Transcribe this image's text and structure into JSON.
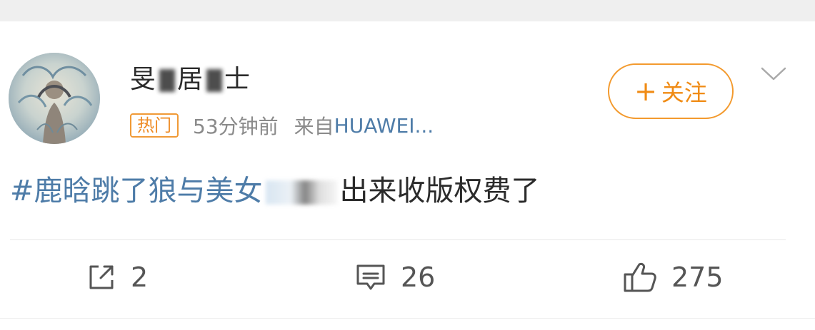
{
  "post": {
    "username": "旻 居 ",
    "username_visible_parts": [
      "旻",
      "居",
      "士"
    ],
    "hot_badge": "热门",
    "time": "53分钟前",
    "source_prefix": "来自",
    "source_name": "HUAWEI...",
    "follow_label": "关注",
    "follow_plus": "+",
    "content_topic": "#鹿晗跳了狼与美女",
    "content_rest": "出来收版权费了"
  },
  "actions": {
    "repost_count": "2",
    "comment_count": "26",
    "like_count": "275"
  },
  "colors": {
    "accent_orange": "#f39a2e",
    "link_blue": "#4e7ca8",
    "meta_gray": "#8a8a8a",
    "text_dark": "#2b2b2b"
  },
  "icons": {
    "avatar": "illustrated-avatar",
    "menu": "chevron-down-icon",
    "repost": "repost-icon",
    "comment": "comment-icon",
    "like": "like-icon"
  }
}
